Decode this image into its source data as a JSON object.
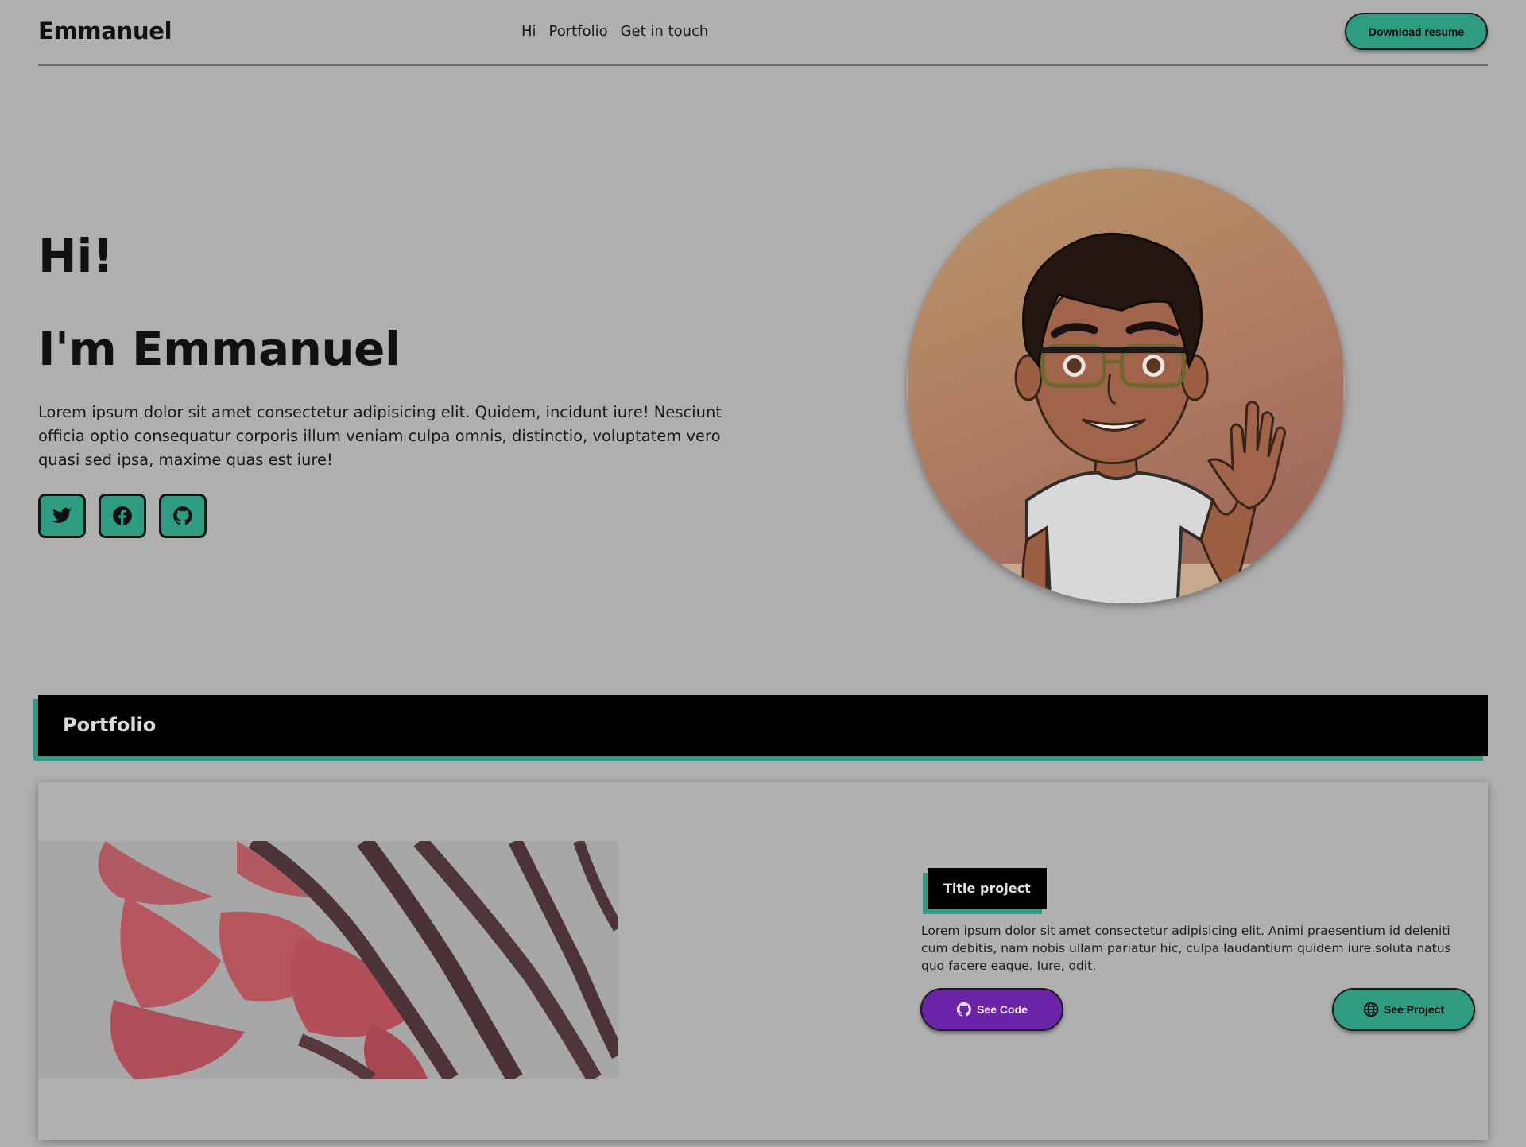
{
  "header": {
    "brand": "Emmanuel",
    "nav": [
      "Hi",
      "Portfolio",
      "Get in touch"
    ],
    "resume_label": "Download resume"
  },
  "hero": {
    "greeting": "Hi!",
    "name": "I'm Emmanuel",
    "description": "Lorem ipsum dolor sit amet consectetur adipisicing elit. Quidem, incidunt iure! Nesciunt officia optio consequatur corporis illum veniam culpa omnis, distinctio, voluptatem vero quasi sed ipsa, maxime quas est iure!",
    "socials": [
      "twitter-icon",
      "facebook-icon",
      "github-icon"
    ]
  },
  "portfolio": {
    "section_title": "Portfolio",
    "project": {
      "title": "Title project",
      "description": "Lorem ipsum dolor sit amet consectetur adipisicing elit. Animi praesentium id deleniti cum debitis, nam nobis ullam pariatur hic, culpa laudantium quidem iure soluta natus quo facere eaque. Iure, odit.",
      "code_label": "See Code",
      "project_label": "See Project"
    }
  },
  "colors": {
    "accent": "#2e9c80",
    "code_button": "#6b23a8",
    "background": "#afafaf"
  }
}
